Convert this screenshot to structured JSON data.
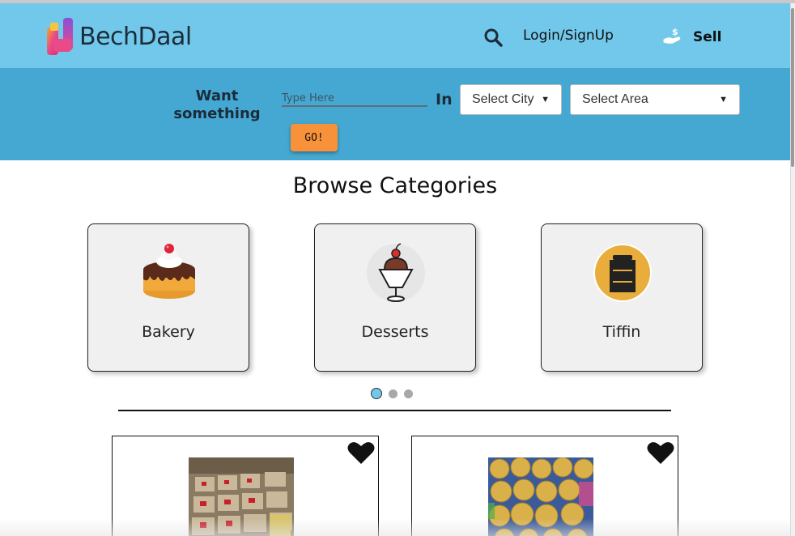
{
  "header": {
    "brand": "BechDaal",
    "login_label": "Login/SignUp",
    "sell_label": "Sell",
    "icons": [
      "logo-icon",
      "search-icon",
      "hand-money-icon"
    ]
  },
  "search": {
    "want_line1": "Want",
    "want_line2": "something",
    "placeholder": "Type Here",
    "in_label": "In",
    "city_select": "Select City",
    "area_select": "Select Area",
    "go_label": "GO!"
  },
  "categories": {
    "title": "Browse Categories",
    "items": [
      {
        "label": "Bakery",
        "icon": "cake-icon"
      },
      {
        "label": "Desserts",
        "icon": "sundae-icon"
      },
      {
        "label": "Tiffin",
        "icon": "tiffin-icon"
      }
    ],
    "carousel_pages": 3,
    "active_page": 1
  },
  "products": [
    {
      "icon": "heart-icon"
    },
    {
      "icon": "heart-icon"
    }
  ],
  "colors": {
    "navbar": "#72c8ea",
    "search_bar": "#45a8d2",
    "go_button": "#f7923a",
    "text_dark": "#1c2c3a"
  }
}
